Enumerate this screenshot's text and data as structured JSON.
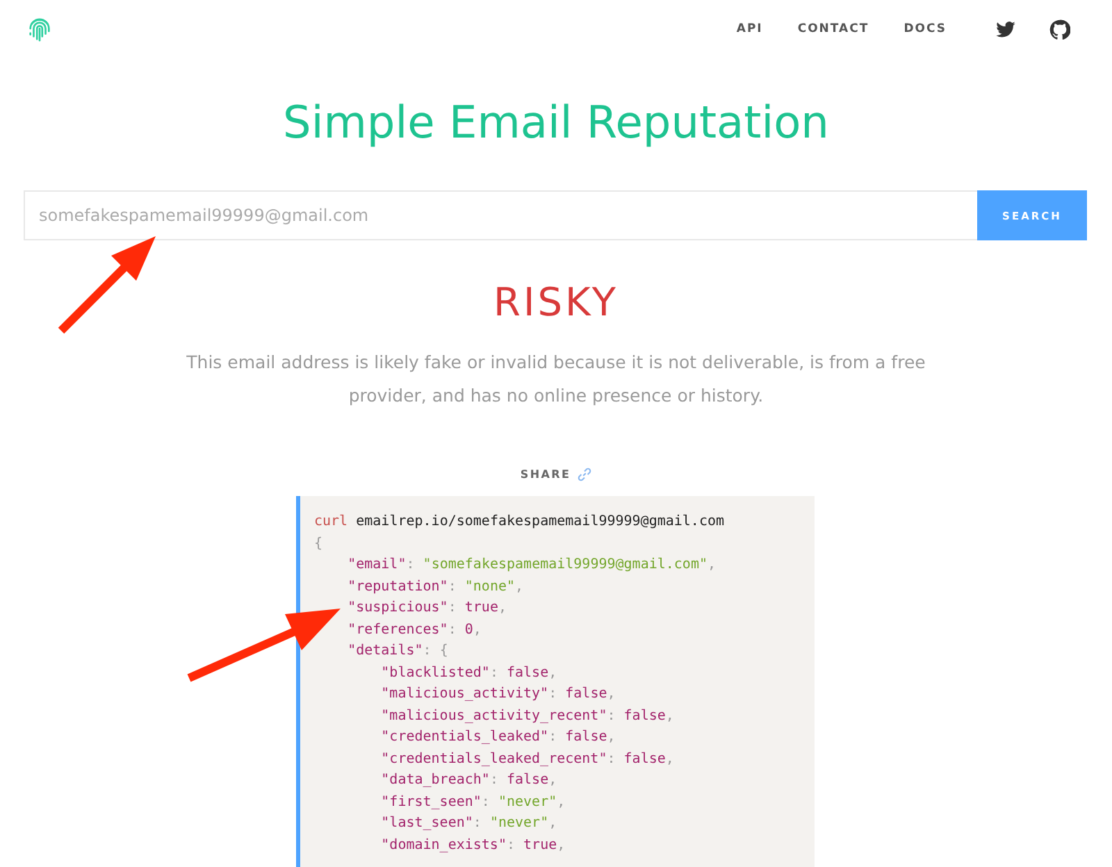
{
  "nav": {
    "links": [
      "API",
      "CONTACT",
      "DOCS"
    ]
  },
  "title": "Simple Email Reputation",
  "search": {
    "value": "somefakespamemail99999@gmail.com",
    "button": "SEARCH"
  },
  "verdict": "RISKY",
  "summary": "This email address is likely fake or invalid because it is not deliverable, is from a free provider, and has no online presence or history.",
  "share": "SHARE",
  "code": {
    "command": "curl",
    "url": "emailrep.io/somefakespamemail99999@gmail.com",
    "open": "{",
    "entries": [
      {
        "key": "\"email\"",
        "sep": ":",
        "value": "\"somefakespamemail99999@gmail.com\"",
        "kind": "string",
        "tail": ","
      },
      {
        "key": "\"reputation\"",
        "sep": ":",
        "value": "\"none\"",
        "kind": "string",
        "tail": ","
      },
      {
        "key": "\"suspicious\"",
        "sep": ":",
        "value": "true",
        "kind": "literal",
        "tail": ","
      },
      {
        "key": "\"references\"",
        "sep": ":",
        "value": "0",
        "kind": "literal",
        "tail": ","
      },
      {
        "key": "\"details\"",
        "sep": ":",
        "value": "{",
        "kind": "punct",
        "children": [
          {
            "key": "\"blacklisted\"",
            "sep": ":",
            "value": "false",
            "kind": "literal",
            "tail": ","
          },
          {
            "key": "\"malicious_activity\"",
            "sep": ":",
            "value": "false",
            "kind": "literal",
            "tail": ","
          },
          {
            "key": "\"malicious_activity_recent\"",
            "sep": ":",
            "value": "false",
            "kind": "literal",
            "tail": ","
          },
          {
            "key": "\"credentials_leaked\"",
            "sep": ":",
            "value": "false",
            "kind": "literal",
            "tail": ","
          },
          {
            "key": "\"credentials_leaked_recent\"",
            "sep": ":",
            "value": "false",
            "kind": "literal",
            "tail": ","
          },
          {
            "key": "\"data_breach\"",
            "sep": ":",
            "value": "false",
            "kind": "literal",
            "tail": ","
          },
          {
            "key": "\"first_seen\"",
            "sep": ":",
            "value": "\"never\"",
            "kind": "string",
            "tail": ","
          },
          {
            "key": "\"last_seen\"",
            "sep": ":",
            "value": "\"never\"",
            "kind": "string",
            "tail": ","
          },
          {
            "key": "\"domain_exists\"",
            "sep": ":",
            "value": "true",
            "kind": "literal",
            "tail": ","
          }
        ]
      }
    ]
  }
}
